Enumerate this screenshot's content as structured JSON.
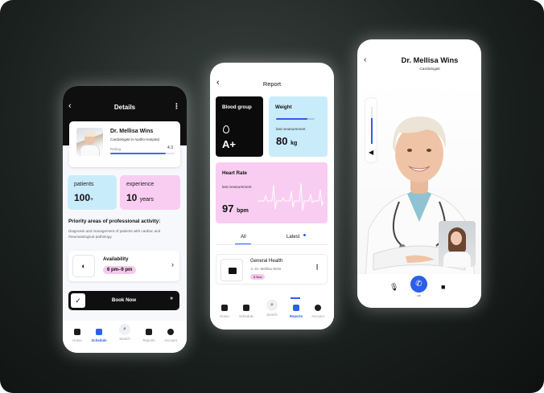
{
  "colors": {
    "accent": "#2b5fe8",
    "blue_card": "#c9ecfb",
    "pink_card": "#f9cdf1",
    "dark": "#0f0f0f"
  },
  "details": {
    "title": "Details",
    "doctor": {
      "name": "Dr. Mellisa Wins",
      "subtitle": "Cardiologist in Apollo Hospital",
      "rating_label": "Rating",
      "rating_value": "4.3",
      "rating_fraction": 0.86
    },
    "patients_label": "patients",
    "patients_value": "100",
    "patients_suffix": "+",
    "experience_label": "experience",
    "experience_value": "10",
    "experience_unit": "years",
    "priority_title": "Priority areas of professional activity:",
    "priority_desc": "Diagnosis and management of patients with cardiac and rheumatological pathology.",
    "availability_label": "Availability",
    "availability_value": "6 pm–9 pm",
    "book_label": "Book Now",
    "tabs": [
      "Home",
      "Schedule",
      "Search",
      "Reports",
      "Account"
    ],
    "active_tab": "Schedule"
  },
  "report": {
    "title": "Report",
    "blood_group_title": "Blood group",
    "blood_group_value": "A+",
    "weight_title": "Weight",
    "weight_label": "last measurement",
    "weight_value": "80",
    "weight_unit": "kg",
    "weight_fraction": 0.82,
    "heart_title": "Heart Rate",
    "heart_label": "last measurement",
    "heart_value": "97",
    "heart_unit": "bpm",
    "segment_all": "All",
    "segment_latest": "Latest",
    "record_title": "General Health",
    "record_doctor": "Dr. Mellisa Wins",
    "record_date": "5 Nov",
    "tabs": [
      "Home",
      "Schedule",
      "Search",
      "Reports",
      "Account"
    ],
    "active_tab": "Reports"
  },
  "call": {
    "doctor_name": "Dr. Mellisa Wins",
    "doctor_role": "Cardiologist",
    "volume_fraction": 0.7,
    "call_label": "call"
  }
}
